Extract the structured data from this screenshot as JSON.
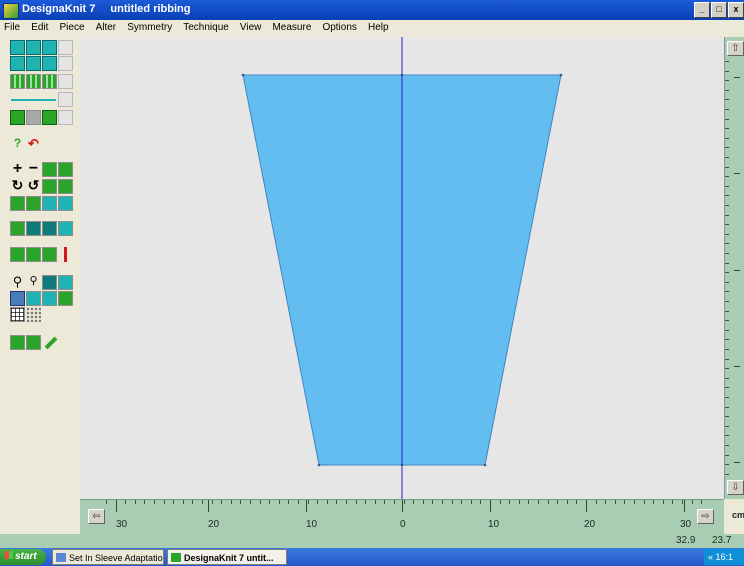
{
  "window": {
    "app_title": "DesignaKnit 7",
    "doc_title": "untitled  ribbing",
    "buttons": [
      "_",
      "□",
      "x"
    ]
  },
  "menu": [
    "File",
    "Edit",
    "Piece",
    "Alter",
    "Symmetry",
    "Technique",
    "View",
    "Measure",
    "Options",
    "Help"
  ],
  "ruler": {
    "labels": [
      "30",
      "20",
      "10",
      "0",
      "10",
      "20",
      "30"
    ],
    "unit": "cm"
  },
  "status": {
    "value1": "32.9",
    "value2": "23.7"
  },
  "taskbar": {
    "start": "start",
    "tasks": [
      {
        "label": "Set In Sleeve Adaptation...",
        "active": false
      },
      {
        "label": "DesignaKnit 7    untit...",
        "active": true
      }
    ],
    "tray_text": "« 16:1"
  },
  "colors": {
    "piece_fill": "#64bdf0",
    "piece_stroke": "#3e86c0",
    "center_line": "#2424c8",
    "canvas": "#e6e6e6",
    "ruler": "#a9cdb2"
  }
}
